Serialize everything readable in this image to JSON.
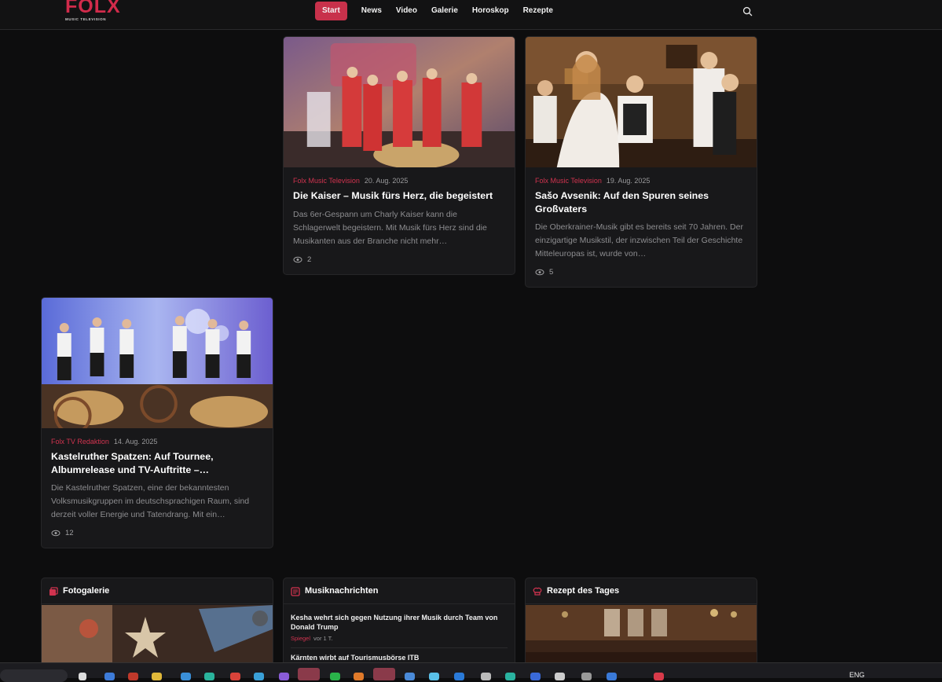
{
  "header": {
    "logo_text": "FOLX",
    "logo_subtext": "MUSIC TELEVISION",
    "nav": [
      "Start",
      "News",
      "Video",
      "Galerie",
      "Horoskop",
      "Rezepte"
    ],
    "active_nav": "Start"
  },
  "articles": [
    {
      "author": "Folx Music Television",
      "date": "20. Aug. 2025",
      "title": "Die Kaiser – Musik fürs Herz, die begeistert",
      "excerpt": "Das 6er-Gespann um Charly Kaiser kann die Schlagerwelt begeistern. Mit Musik fürs Herz sind die Musikanten aus der Branche nicht mehr…",
      "views": "2"
    },
    {
      "author": "Folx Music Television",
      "date": "19. Aug. 2025",
      "title": "Sašo Avsenik: Auf den Spuren seines Großvaters",
      "excerpt": "Die Oberkrainer-Musik gibt es bereits seit 70 Jahren. Der einzigartige Musikstil, der inzwischen Teil der Geschichte Mitteleuropas ist, wurde von…",
      "views": "5"
    },
    {
      "author": "Folx TV Redaktion",
      "date": "14. Aug. 2025",
      "title": "Kastelruther Spatzen: Auf Tournee, Albumrelease und TV-Auftritte –…",
      "excerpt": "Die Kastelruther Spatzen, eine der bekanntesten Volksmusikgruppen im deutschsprachigen Raum, sind derzeit voller Energie und Tatendrang. Mit ein…",
      "views": "12"
    }
  ],
  "widgets": {
    "gallery": {
      "title": "Fotogalerie"
    },
    "music_news": {
      "title": "Musiknachrichten",
      "items": [
        {
          "title": "Kesha wehrt sich gegen Nutzung ihrer Musik durch Team von Donald Trump",
          "source": "Spiegel",
          "ago": "vor 1 T."
        },
        {
          "title": "Kärnten wirbt auf Tourismusbörse ITB",
          "source": "",
          "ago": ""
        }
      ]
    },
    "recipe": {
      "title": "Rezept des Tages"
    }
  },
  "taskbar": {
    "lang": "ENG"
  },
  "colors": {
    "accent": "#c8314b",
    "background": "#0d0d0e",
    "card": "#18181a"
  }
}
